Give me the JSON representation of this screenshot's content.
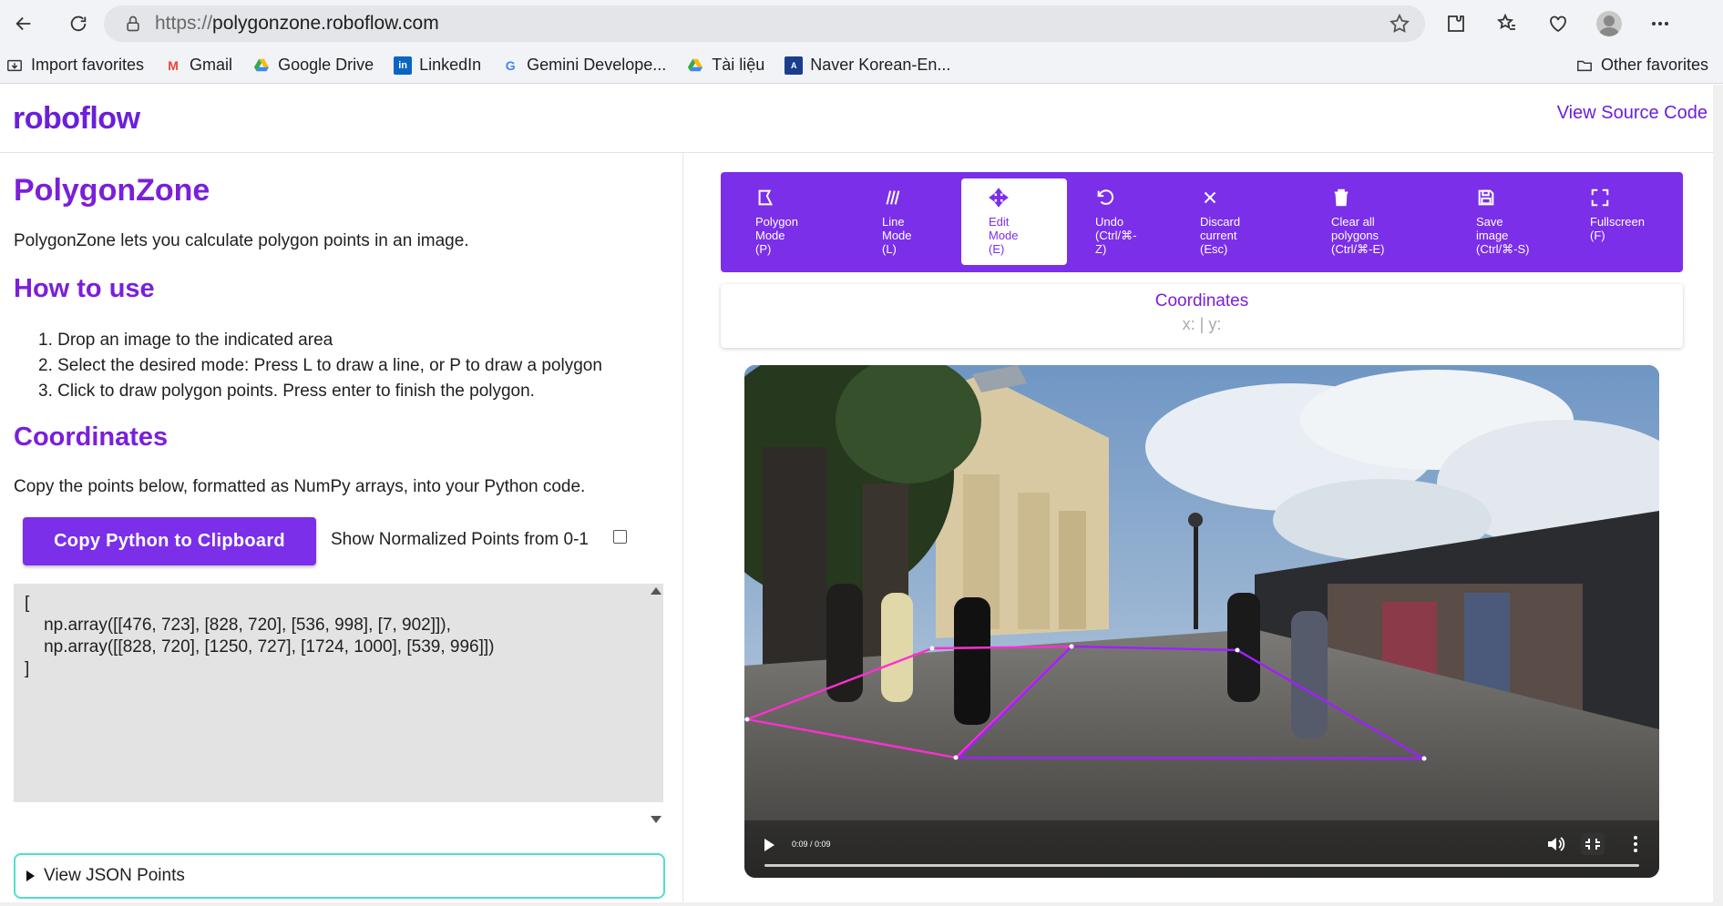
{
  "browser": {
    "url_proto": "https://",
    "url_host": "polygonzone.roboflow.com",
    "bookmarks": [
      {
        "label": "Import favorites",
        "icon": "import-icon"
      },
      {
        "label": "Gmail",
        "icon": "gmail-icon"
      },
      {
        "label": "Google Drive",
        "icon": "google-drive-icon"
      },
      {
        "label": "LinkedIn",
        "icon": "linkedin-icon"
      },
      {
        "label": "Gemini Develope...",
        "icon": "google-icon"
      },
      {
        "label": "Tài liệu",
        "icon": "google-drive-icon"
      },
      {
        "label": "Naver Korean-En...",
        "icon": "naver-dictionary-icon"
      }
    ],
    "other_favorites": "Other favorites"
  },
  "header": {
    "logo": "roboflow",
    "view_source": "View Source Code",
    "brand_color": "#6b1fd9"
  },
  "left": {
    "title": "PolygonZone",
    "description": "PolygonZone lets you calculate polygon points in an image.",
    "how_to_use": "How to use",
    "steps": [
      "1. Drop an image to the indicated area",
      "2. Select the desired mode: Press L to draw a line, or P to draw a polygon",
      "3. Click to draw polygon points. Press enter to finish the polygon."
    ],
    "coordinates_heading": "Coordinates",
    "copy_description": "Copy the points below, formatted as NumPy arrays, into your Python code.",
    "copy_button": "Copy Python to Clipboard",
    "normalized_label": "Show Normalized Points from 0-1",
    "normalized_checked": false,
    "code": "[\n    np.array([[476, 723], [828, 720], [536, 998], [7, 902]]),\n    np.array([[828, 720], [1250, 727], [1724, 1000], [539, 996]])\n]",
    "view_json": "View JSON Points"
  },
  "toolbar": {
    "tools": [
      {
        "label": "Polygon\nMode\n(P)",
        "icon": "polygon-icon",
        "active": false
      },
      {
        "label": "Line\nMode\n(L)",
        "icon": "line-icon",
        "active": false
      },
      {
        "label": "Edit\nMode\n(E)",
        "icon": "move-icon",
        "active": true
      },
      {
        "label": "Undo\n(Ctrl/⌘-\nZ)",
        "icon": "undo-icon",
        "active": false
      },
      {
        "label": "Discard\ncurrent\n(Esc)",
        "icon": "close-icon",
        "active": false
      },
      {
        "label": "Clear all\npolygons\n(Ctrl/⌘-E)",
        "icon": "trash-icon",
        "active": false
      },
      {
        "label": "Save\nimage\n(Ctrl/⌘-S)",
        "icon": "save-icon",
        "active": false
      },
      {
        "label": "Fullscreen\n(F)",
        "icon": "fullscreen-icon",
        "active": false
      }
    ]
  },
  "coordinates_panel": {
    "title": "Coordinates",
    "value": "x: | y:"
  },
  "video": {
    "time": "0:09 / 0:09",
    "polygon_colors": [
      "#ff2fd0",
      "#a020ff"
    ]
  }
}
